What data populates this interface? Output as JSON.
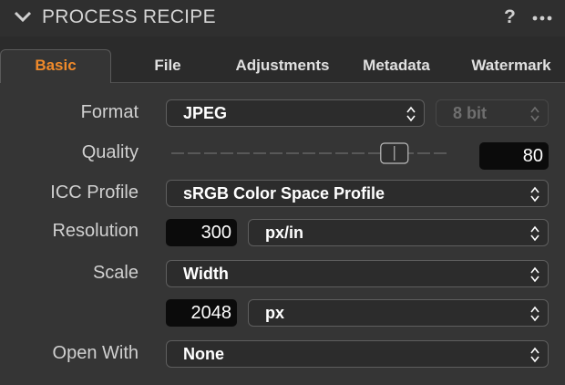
{
  "header": {
    "title": "PROCESS RECIPE",
    "help": "?",
    "collapse_icon": "chevron-down-icon",
    "more_icon": "ellipsis-icon"
  },
  "tabs": [
    {
      "label": "Basic",
      "active": true
    },
    {
      "label": "File",
      "active": false
    },
    {
      "label": "Adjustments",
      "active": false
    },
    {
      "label": "Metadata",
      "active": false
    },
    {
      "label": "Watermark",
      "active": false
    }
  ],
  "format": {
    "label": "Format",
    "value": "JPEG",
    "bit_depth": "8 bit"
  },
  "quality": {
    "label": "Quality",
    "value": "80",
    "slider_fraction": 0.8
  },
  "icc": {
    "label": "ICC Profile",
    "value": "sRGB Color Space Profile"
  },
  "resolution": {
    "label": "Resolution",
    "value": "300",
    "unit": "px/in"
  },
  "scale": {
    "label": "Scale",
    "mode": "Width",
    "value": "2048",
    "unit": "px"
  },
  "open_with": {
    "label": "Open With",
    "value": "None"
  },
  "colors": {
    "accent": "#f08a2a",
    "panel": "#353535",
    "field": "#0b0b0b"
  }
}
